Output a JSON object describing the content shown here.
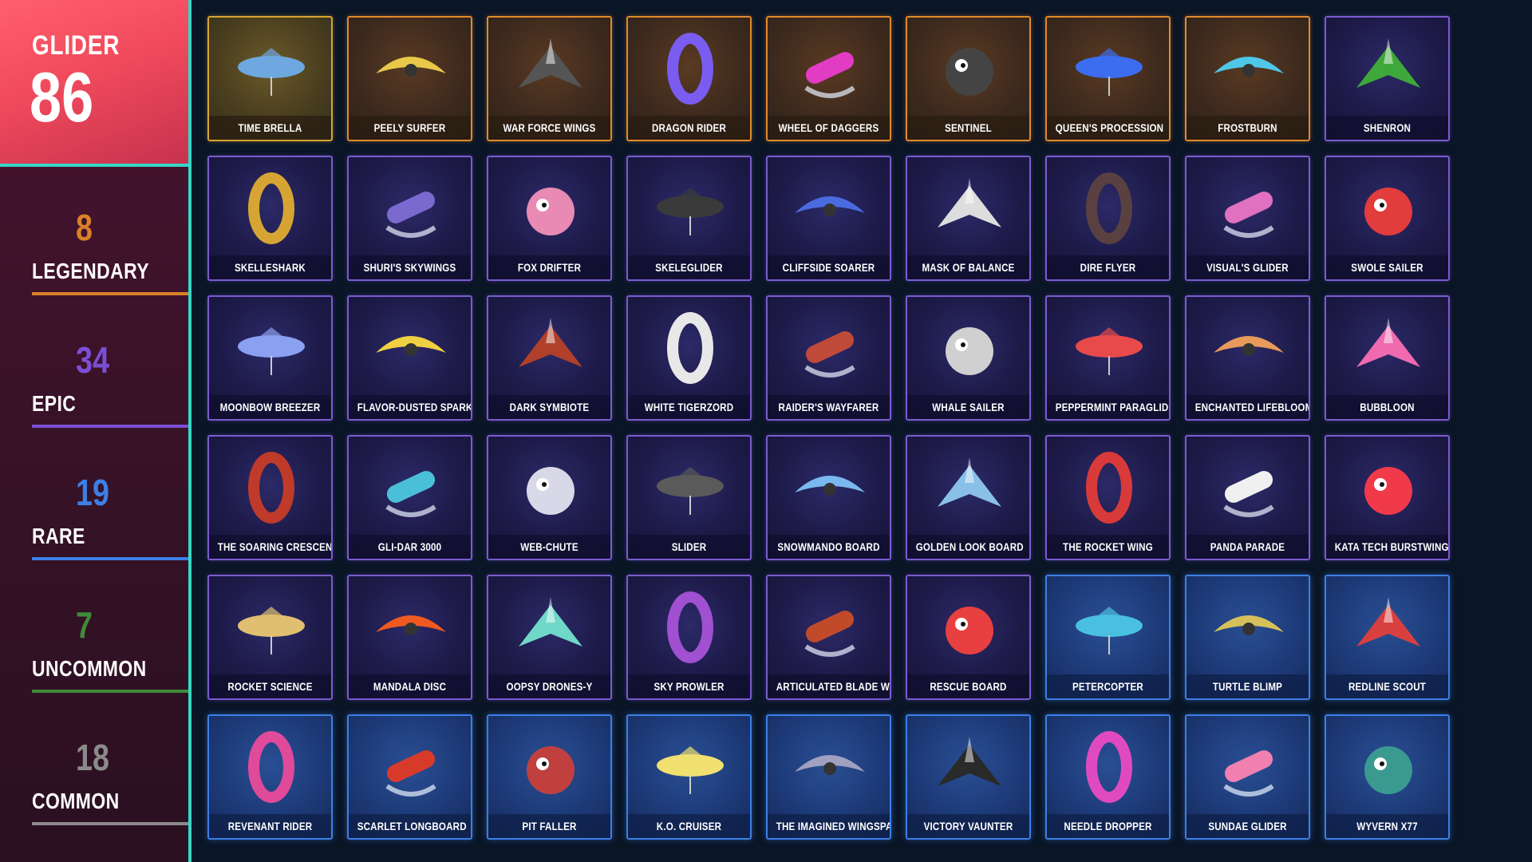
{
  "summary": {
    "title": "GLIDER",
    "total": "86"
  },
  "rarities": [
    {
      "count": "8",
      "name": "LEGENDARY",
      "color": "#d9802a"
    },
    {
      "count": "34",
      "name": "EPIC",
      "color": "#7a4fd6"
    },
    {
      "count": "19",
      "name": "RARE",
      "color": "#3c7fe6"
    },
    {
      "count": "7",
      "name": "UNCOMMON",
      "color": "#3f8c3a"
    },
    {
      "count": "18",
      "name": "COMMON",
      "color": "#8a8a8a"
    }
  ],
  "gliders": [
    {
      "name": "TIME BRELLA",
      "rarity": "legendary-gold",
      "icon": "umbrella-glider-icon",
      "accent": "#6fa8e0"
    },
    {
      "name": "PEELY SURFER",
      "rarity": "legendary",
      "icon": "banana-board-icon",
      "accent": "#e8c84a"
    },
    {
      "name": "WAR FORCE WINGS",
      "rarity": "legendary",
      "icon": "dark-wings-icon",
      "accent": "#555555"
    },
    {
      "name": "DRAGON RIDER",
      "rarity": "legendary",
      "icon": "dragon-icon",
      "accent": "#7a5cf0"
    },
    {
      "name": "WHEEL OF DAGGERS",
      "rarity": "legendary",
      "icon": "ring-icon",
      "accent": "#e23cc4"
    },
    {
      "name": "SENTINEL",
      "rarity": "legendary",
      "icon": "spider-mech-icon",
      "accent": "#444444"
    },
    {
      "name": "QUEEN'S PROCESSION",
      "rarity": "legendary",
      "icon": "flame-wing-icon",
      "accent": "#3c6cf0"
    },
    {
      "name": "FROSTBURN",
      "rarity": "legendary",
      "icon": "ice-wing-icon",
      "accent": "#4fc8e8"
    },
    {
      "name": "SHENRON",
      "rarity": "epic",
      "icon": "green-dragon-icon",
      "accent": "#3fa83a"
    },
    {
      "name": "SKELLESHARK",
      "rarity": "epic",
      "icon": "gold-shark-icon",
      "accent": "#d6a433"
    },
    {
      "name": "SHURI'S SKYWINGS",
      "rarity": "epic",
      "icon": "purple-wing-icon",
      "accent": "#7a6ad0"
    },
    {
      "name": "FOX DRIFTER",
      "rarity": "epic",
      "icon": "fox-glider-icon",
      "accent": "#e88ab4"
    },
    {
      "name": "SKELEGLIDER",
      "rarity": "epic",
      "icon": "skeleton-wing-icon",
      "accent": "#3a3a3a"
    },
    {
      "name": "CLIFFSIDE SOARER",
      "rarity": "epic",
      "icon": "jet-glider-icon",
      "accent": "#4a6ae0"
    },
    {
      "name": "MASK OF BALANCE",
      "rarity": "epic",
      "icon": "mask-icon",
      "accent": "#dddddd"
    },
    {
      "name": "DIRE FLYER",
      "rarity": "epic",
      "icon": "bat-wing-icon",
      "accent": "#5a4040"
    },
    {
      "name": "VISUAL'S GLIDER",
      "rarity": "epic",
      "icon": "bunny-glider-icon",
      "accent": "#e070c0"
    },
    {
      "name": "SWOLE SAILER",
      "rarity": "epic",
      "icon": "red-fish-icon",
      "accent": "#e23c3c"
    },
    {
      "name": "MOONBOW BREEZER",
      "rarity": "epic",
      "icon": "moon-wing-icon",
      "accent": "#8aa0f0"
    },
    {
      "name": "FLAVOR-DUSTED SPARKLEWINGS",
      "rarity": "epic",
      "icon": "rainbow-wing-icon",
      "accent": "#f0d040"
    },
    {
      "name": "DARK SYMBIOTE",
      "rarity": "epic",
      "icon": "symbiote-icon",
      "accent": "#b0402a"
    },
    {
      "name": "WHITE TIGERZORD",
      "rarity": "epic",
      "icon": "tiger-mech-icon",
      "accent": "#e8e8e8"
    },
    {
      "name": "RAIDER'S WAYFARER",
      "rarity": "epic",
      "icon": "rocket-glider-icon",
      "accent": "#c04a3a"
    },
    {
      "name": "WHALE SAILER",
      "rarity": "epic",
      "icon": "whale-icon",
      "accent": "#d0d0d0"
    },
    {
      "name": "PEPPERMINT PARAGLIDER",
      "rarity": "epic",
      "icon": "peppermint-wing-icon",
      "accent": "#e84a4a"
    },
    {
      "name": "ENCHANTED LIFEBLOOM",
      "rarity": "epic",
      "icon": "flower-icon",
      "accent": "#e89a5a"
    },
    {
      "name": "BUBBLOON",
      "rarity": "epic",
      "icon": "pink-fish-icon",
      "accent": "#f06ab0"
    },
    {
      "name": "THE SOARING CRESCENT",
      "rarity": "epic",
      "icon": "crescent-icon",
      "accent": "#c03a2a"
    },
    {
      "name": "GLI-DAR 3000",
      "rarity": "epic",
      "icon": "hover-pod-icon",
      "accent": "#4ac0d8"
    },
    {
      "name": "WEB-CHUTE",
      "rarity": "epic",
      "icon": "web-chute-icon",
      "accent": "#d8d8e8"
    },
    {
      "name": "SLIDER",
      "rarity": "epic",
      "icon": "slider-wing-icon",
      "accent": "#5a5a5a"
    },
    {
      "name": "SNOWMANDO BOARD",
      "rarity": "epic",
      "icon": "snow-board-icon",
      "accent": "#7ab8f0"
    },
    {
      "name": "GOLDEN LOOK BOARD",
      "rarity": "epic",
      "icon": "gold-board-icon",
      "accent": "#8ac0e8"
    },
    {
      "name": "THE ROCKET WING",
      "rarity": "epic",
      "icon": "rocket-wing-icon",
      "accent": "#d83a3a"
    },
    {
      "name": "PANDA PARADE",
      "rarity": "epic",
      "icon": "panda-icon",
      "accent": "#f0f0f0"
    },
    {
      "name": "KATA TECH BURSTWING",
      "rarity": "epic",
      "icon": "laser-wing-icon",
      "accent": "#f03a4a"
    },
    {
      "name": "ROCKET SCIENCE",
      "rarity": "epic",
      "icon": "rocket-icon",
      "accent": "#e0c070"
    },
    {
      "name": "MANDALA DISC",
      "rarity": "epic",
      "icon": "mandala-icon",
      "accent": "#f05a20"
    },
    {
      "name": "OOPSY DRONES-Y",
      "rarity": "epic",
      "icon": "drone-icon",
      "accent": "#70d8c8"
    },
    {
      "name": "SKY PROWLER",
      "rarity": "epic",
      "icon": "prowler-wing-icon",
      "accent": "#a050d0"
    },
    {
      "name": "ARTICULATED BLADE WING",
      "rarity": "epic",
      "icon": "blade-wing-icon",
      "accent": "#c04a2a"
    },
    {
      "name": "RESCUE BOARD",
      "rarity": "epic",
      "icon": "rescue-board-icon",
      "accent": "#e84040"
    },
    {
      "name": "PETERCOPTER",
      "rarity": "rare",
      "icon": "helicopter-icon",
      "accent": "#4ac0e0"
    },
    {
      "name": "TURTLE BLIMP",
      "rarity": "rare",
      "icon": "turtle-blimp-icon",
      "accent": "#d6c05a"
    },
    {
      "name": "REDLINE SCOUT",
      "rarity": "rare",
      "icon": "scout-wing-icon",
      "accent": "#d84040"
    },
    {
      "name": "REVENANT RIDER",
      "rarity": "rare",
      "icon": "revenant-icon",
      "accent": "#e04a9a"
    },
    {
      "name": "SCARLET LONGBOARD",
      "rarity": "rare",
      "icon": "longboard-icon",
      "accent": "#d83a2a"
    },
    {
      "name": "PIT FALLER",
      "rarity": "rare",
      "icon": "pit-glider-icon",
      "accent": "#c04040"
    },
    {
      "name": "K.O. CRUISER",
      "rarity": "rare",
      "icon": "cruiser-icon",
      "accent": "#f0e070"
    },
    {
      "name": "THE IMAGINED WINGSPAN",
      "rarity": "rare",
      "icon": "wingspan-icon",
      "accent": "#a0a0c0"
    },
    {
      "name": "VICTORY VAUNTER",
      "rarity": "rare",
      "icon": "car-glider-icon",
      "accent": "#2a2a2a"
    },
    {
      "name": "NEEDLE DROPPER",
      "rarity": "rare",
      "icon": "record-board-icon",
      "accent": "#e04ac0"
    },
    {
      "name": "SUNDAE GLIDER",
      "rarity": "rare",
      "icon": "sundae-icon",
      "accent": "#f080b0"
    },
    {
      "name": "WYVERN X77",
      "rarity": "rare",
      "icon": "wyvern-icon",
      "accent": "#3a9a90"
    }
  ]
}
